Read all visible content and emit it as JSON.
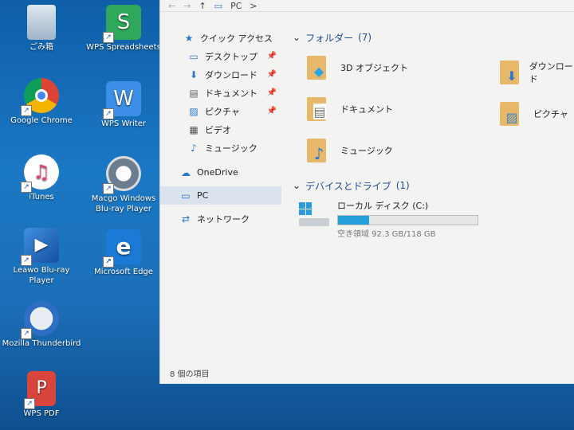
{
  "desktop": {
    "icons": [
      {
        "label": "ごみ箱",
        "icon": "recycle-bin-icon"
      },
      {
        "label": "WPS Spreadsheets",
        "icon": "wps-spreadsheets-icon"
      },
      {
        "label": "Google Chrome",
        "icon": "chrome-icon"
      },
      {
        "label": "WPS Writer",
        "icon": "wps-writer-icon"
      },
      {
        "label": "iTunes",
        "icon": "itunes-icon"
      },
      {
        "label": "Macgo Windows Blu-ray Player",
        "icon": "macgo-bluray-icon"
      },
      {
        "label": "Leawo Blu-ray Player",
        "icon": "leawo-bluray-icon"
      },
      {
        "label": "Microsoft Edge",
        "icon": "edge-icon"
      },
      {
        "label": "Mozilla Thunderbird",
        "icon": "thunderbird-icon"
      },
      {
        "label": "WPS PDF",
        "icon": "wps-pdf-icon"
      }
    ]
  },
  "explorer": {
    "breadcrumb": {
      "root": "PC",
      "sep": ">"
    },
    "nav": {
      "quick_access": "クイック アクセス",
      "items": [
        {
          "label": "デスクトップ",
          "pinned": true
        },
        {
          "label": "ダウンロード",
          "pinned": true
        },
        {
          "label": "ドキュメント",
          "pinned": true
        },
        {
          "label": "ピクチャ",
          "pinned": true
        },
        {
          "label": "ビデオ",
          "pinned": false
        },
        {
          "label": "ミュージック",
          "pinned": false
        }
      ],
      "onedrive": "OneDrive",
      "pc": "PC",
      "network": "ネットワーク"
    },
    "folders_section": {
      "title": "フォルダー",
      "count": "(7)"
    },
    "folders": [
      {
        "label": "3D オブジェクト"
      },
      {
        "label": "ダウンロード"
      },
      {
        "label": "ドキュメント"
      },
      {
        "label": "ピクチャ"
      },
      {
        "label": "ミュージック"
      }
    ],
    "drives_section": {
      "title": "デバイスとドライブ",
      "count": "(1)"
    },
    "drive": {
      "label": "ローカル ディスク (C:)",
      "free_text": "空き領域 92.3 GB/118 GB",
      "used_fraction": 0.22
    },
    "status": "8 個の項目"
  },
  "colors": {
    "accent": "#26a0da",
    "folder": "#e8b86a",
    "section": "#1e4f91"
  }
}
